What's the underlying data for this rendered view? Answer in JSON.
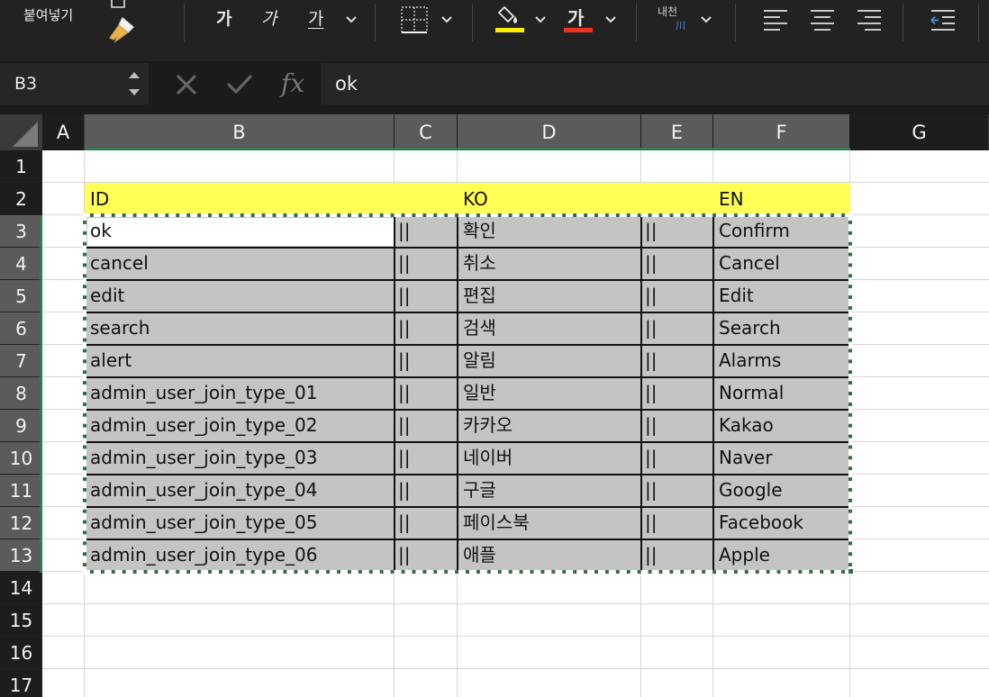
{
  "ribbon": {
    "paste_label": "붙여넣기",
    "bold_glyph": "가",
    "italic_glyph": "가",
    "underline_glyph": "가",
    "font_color_glyph": "가",
    "phonetic_label": "내천",
    "phonetic_sub": "川",
    "fill_color": "#ffee00",
    "font_color": "#ee3324"
  },
  "formula_bar": {
    "name_box": "B3",
    "formula": "ok"
  },
  "columns": [
    "A",
    "B",
    "C",
    "D",
    "E",
    "F",
    "G"
  ],
  "rows": [
    "1",
    "2",
    "3",
    "4",
    "5",
    "6",
    "7",
    "8",
    "9",
    "10",
    "11",
    "12",
    "13",
    "14",
    "15",
    "16",
    "17"
  ],
  "sheet": {
    "header": {
      "id": "ID",
      "ko": "KO",
      "en": "EN"
    },
    "data": [
      {
        "id": "ok",
        "sep1": "||",
        "ko": "확인",
        "sep2": "||",
        "en": "Confirm"
      },
      {
        "id": "cancel",
        "sep1": "||",
        "ko": "취소",
        "sep2": "||",
        "en": "Cancel"
      },
      {
        "id": "edit",
        "sep1": "||",
        "ko": "편집",
        "sep2": "||",
        "en": "Edit"
      },
      {
        "id": "search",
        "sep1": "||",
        "ko": "검색",
        "sep2": "||",
        "en": "Search"
      },
      {
        "id": "alert",
        "sep1": "||",
        "ko": "알림",
        "sep2": "||",
        "en": "Alarms"
      },
      {
        "id": "admin_user_join_type_01",
        "sep1": "||",
        "ko": "일반",
        "sep2": "||",
        "en": "Normal"
      },
      {
        "id": "admin_user_join_type_02",
        "sep1": "||",
        "ko": "카카오",
        "sep2": "||",
        "en": "Kakao"
      },
      {
        "id": "admin_user_join_type_03",
        "sep1": "||",
        "ko": "네이버",
        "sep2": "||",
        "en": "Naver"
      },
      {
        "id": "admin_user_join_type_04",
        "sep1": "||",
        "ko": "구글",
        "sep2": "||",
        "en": "Google"
      },
      {
        "id": "admin_user_join_type_05",
        "sep1": "||",
        "ko": "페이스북",
        "sep2": "||",
        "en": "Facebook"
      },
      {
        "id": "admin_user_join_type_06",
        "sep1": "||",
        "ko": "애플",
        "sep2": "||",
        "en": "Apple"
      }
    ]
  },
  "colors": {
    "header_band": "#ffff55",
    "selection_fill": "#c4c4c4",
    "selection_border": "#356b45"
  }
}
